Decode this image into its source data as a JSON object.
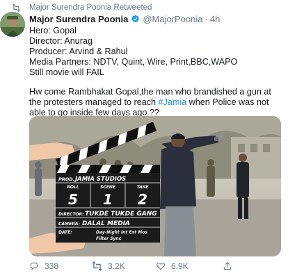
{
  "retweet": {
    "text": "Major Surendra Poonia Retweeted",
    "icon": "retweet-icon"
  },
  "tweet": {
    "author_name": "Major Surendra Poonia",
    "handle": "@MajorPoonia",
    "separator": "·",
    "time": "4h",
    "lines": [
      "Hero: Gopal",
      "Director: Anurag",
      "Producer: Arvind & Rahul",
      "Media Partners: NDTV, Quint, Wire, Print,BBC,WAPO",
      "Still movie will FAIL"
    ],
    "para2_before": "Hw come Rambhakat Gopal,the man who brandished a gun at the protesters managed to reach ",
    "hashtag": "#Jamia",
    "para2_after": " when Police was not able to go inside few days ago ??"
  },
  "clapperboard": {
    "prod_label": "PROD.",
    "prod_value": "JAMIA STUDIOS",
    "roll_label": "ROLL",
    "scene_label": "SCENE",
    "take_label": "TAKE",
    "roll_value": "5",
    "scene_value": "1",
    "take_value": "2",
    "director_label": "DIRECTOR:",
    "director_value": "TUKDE TUKDE GANG",
    "camera_label": "CAMERA:",
    "camera_value": "DALAL MEDIA",
    "date_label": "DATE:",
    "footer_line1": "Day-Night  Int  Ext  Mos",
    "footer_line2": "Filter                    Sync"
  },
  "actions": {
    "replies": "338",
    "retweets": "3.2K",
    "likes": "6.9K"
  },
  "colors": {
    "muted": "#657786",
    "link": "#1b95e0",
    "verified": "#1da1f2"
  }
}
